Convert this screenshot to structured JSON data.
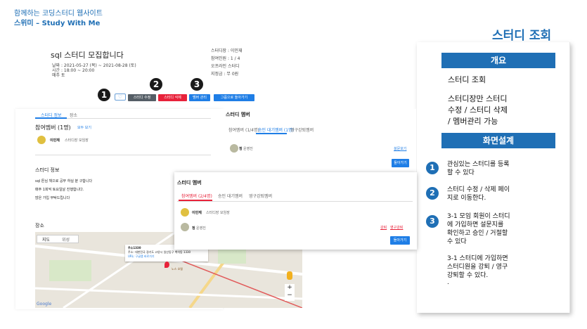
{
  "brand": {
    "line1": "함께하는 코딩스터디 웹사이트",
    "line2": "스위미 – Study With Me"
  },
  "page_title": "스터디 조회",
  "panel": {
    "overview_header": "개요",
    "overview_line1": "스터디 조회",
    "overview_line2": "스터디장만 스터디",
    "overview_line3": "수정 / 스터디 삭제",
    "overview_line4": "/ 멤버관리 가능",
    "design_header": "화면설계",
    "item1_line1": "관심있는 스터디를 등록",
    "item1_line2": "할 수 있다",
    "item2_line1": "스터디 수정 / 삭제 페이",
    "item2_line2": "지로 이동한다.",
    "item3_line1": "3-1 모임 회원이 스터디",
    "item3_line2": "에 가입하면 설문지를",
    "item3_line3": "확인하고 승인 / 거절할",
    "item3_line4": "수 있다",
    "item3_line5": "3-1 스터디에 가입하면",
    "item3_line6": "스터디원을 강퇴 / 영구",
    "item3_line7": "강퇴할 수 있다.",
    "item3_line8": "."
  },
  "numbers": [
    "1",
    "2",
    "3"
  ],
  "study": {
    "title": "sql 스터디 모집합니다",
    "period": "날짜 : 2021-05-27 (목) ~ 2021-08-28 (토)",
    "time": "시간 : 18:00 ~ 20:00",
    "days": "매주 토",
    "leader": "스터디장 : 이민재",
    "members": "참여인원 : 1 / 4",
    "mode": "오프라인 스터디",
    "place": "지정금 : 무 0원",
    "heart": "♡",
    "btn_edit": "스터디 수정",
    "btn_delete": "스터디 삭제",
    "btn_manage": "멤버 관리",
    "btn_group": "그룹으로 돌아가기"
  },
  "left": {
    "tab_info": "스터디 정보",
    "tab_etc": "장소",
    "members_title": "참여멤버 (1명)",
    "members_more": "모두 보기",
    "member_name": "이민재",
    "member_role": "스터디장 모임장",
    "info_title": "스터디 정보",
    "info_line1": "sql 튼님 책으로 공부 하실 분 구합니다",
    "info_line2": "매주 1회씩 토요일날 진행합니다.",
    "info_line3": "많은 가입 부탁드립니다",
    "place_title": "장소",
    "map_tab1": "지도",
    "map_tab2": "위성",
    "map_label1": "주소1330",
    "map_label2": "주소: 대한민국 경기도 고양시 일산동구 백석동 1330",
    "map_label3": "URL: 구글맵 바로가기",
    "map_label4": "노스 호텔",
    "google": "Google"
  },
  "mid": {
    "title": "스터디 멤버",
    "tab1": "참여멤버 (1/4명)",
    "tab2": "승인 대기멤버 (1명)",
    "tab3": "영구강퇴멤버",
    "pending_name": "정",
    "pending_role": "운영진",
    "survey": "설문보기",
    "back": "돌아가기"
  },
  "pop": {
    "title": "스터디 멤버",
    "tab1": "참여멤버 (2/4명)",
    "tab2": "승인 대기멤버",
    "tab3": "영구강퇴멤버",
    "m1_name": "이민재",
    "m1_role": "스터디장 모임장",
    "m2_name": "정",
    "m2_role": "운영진",
    "kick": "강퇴",
    "perm_kick": "영구강퇴",
    "back": "돌아가기"
  },
  "colors": {
    "accent": "#1f6fb5",
    "danger": "#e8223a",
    "primary": "#1f7ee6",
    "dark": "#555e66"
  }
}
